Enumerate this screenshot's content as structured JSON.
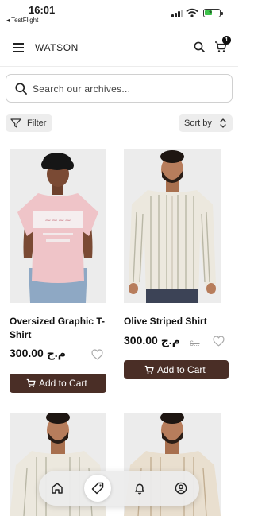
{
  "status_bar": {
    "time": "16:01",
    "back_app": "◂ TestFlight"
  },
  "header": {
    "brand": "WATSON",
    "cart_count": "1"
  },
  "search": {
    "placeholder": "Search our archives..."
  },
  "toolbar": {
    "filter_label": "Filter",
    "sort_label": "Sort by"
  },
  "products": [
    {
      "title": "Oversized Graphic T-Shirt",
      "price": "300.00 م.ج",
      "old_price": "",
      "add_label": "Add to Cart"
    },
    {
      "title": "Olive Striped Shirt",
      "price": "300.00 م.ج",
      "old_price": "6...",
      "add_label": "Add to Cart"
    }
  ],
  "tab_bar": {
    "items": [
      "home-icon",
      "tag-icon",
      "bell-icon",
      "profile-icon"
    ],
    "active": "tag-icon"
  },
  "colors": {
    "accent": "#4a2e26",
    "chip_bg": "#ededed"
  }
}
